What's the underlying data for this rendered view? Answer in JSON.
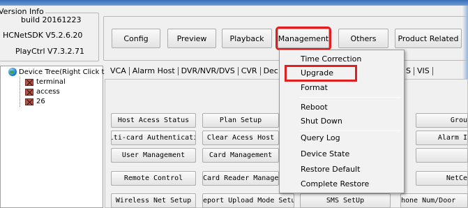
{
  "version_info": {
    "legend": "Version Info",
    "build": "build 20161223",
    "sdk": "HCNetSDK V5.2.6.20",
    "playctrl": "PlayCtrl V7.3.2.71"
  },
  "toolbar": {
    "config": "Config",
    "preview": "Preview",
    "playback": "Playback",
    "management": "Management",
    "others": "Others",
    "product_related": "Product Related"
  },
  "device_tree": {
    "root": "Device Tree(Right Click t",
    "nodes": [
      "terminal",
      "access",
      "26"
    ]
  },
  "tabs": [
    "VCA",
    "Alarm Host",
    "DVR/NVR/DVS",
    "CVR",
    "Dec",
    "S",
    "VIS"
  ],
  "buttons": {
    "host_acess_status": "Host Acess Status",
    "plan_setup": "Plan Setup",
    "gro": "Grou",
    "multi_card": "lti-card Authenticati",
    "clear_acess_host": "Clear Acess Host",
    "alarm_i": "Alarm I",
    "user_management": "User Management",
    "card_management": "Card Management",
    "remote_control": "Remote Control",
    "card_reader": "Card Reader Managem",
    "netce": "NetCe",
    "wireless_net_setup": "Wireless Net Setup",
    "report_upload": "eport Upload Mode Setu",
    "sms_setup": "SMS SetUp",
    "phone_num": "hone Num/Door"
  },
  "menu": {
    "items": {
      "time_correction": "Time Correction",
      "upgrade": "Upgrade",
      "format": "Format",
      "reboot": "Reboot",
      "shut_down": "Shut Down",
      "query_log": "Query Log",
      "device_state": "Device State",
      "restore_default": "Restore Default",
      "complete_restore": "Complete Restore"
    }
  },
  "colors": {
    "highlight": "#e02020",
    "title_bar": "#3a6fb8"
  }
}
